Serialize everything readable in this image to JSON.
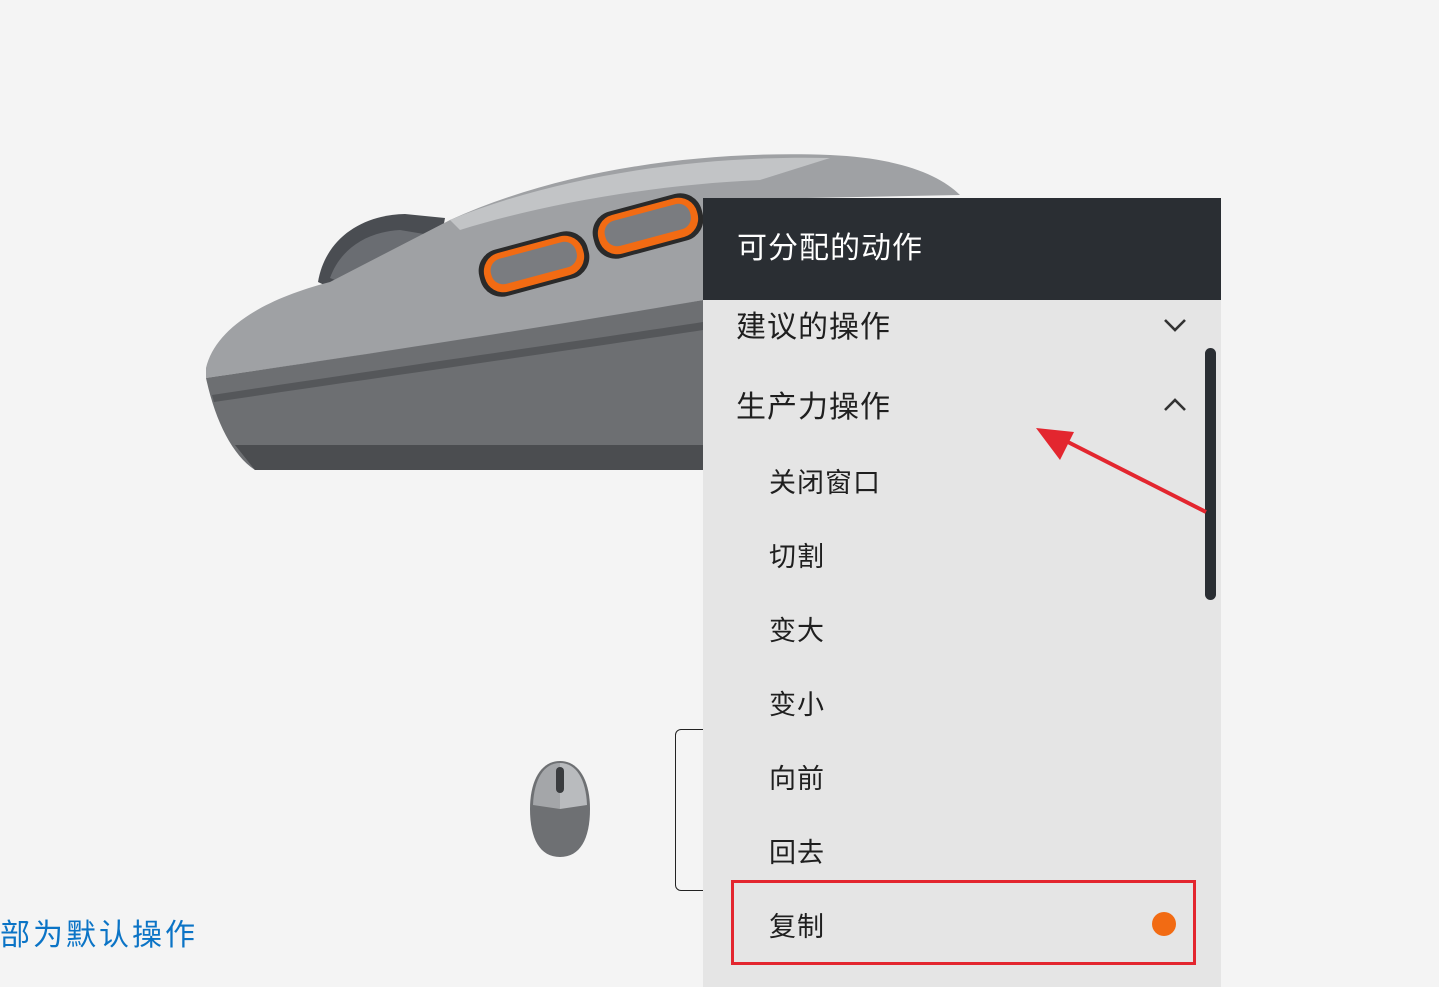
{
  "panel": {
    "title": "可分配的动作",
    "sections": [
      {
        "label": "建议的操作",
        "expanded": false,
        "icon": "chevron-down-icon"
      },
      {
        "label": "生产力操作",
        "expanded": true,
        "icon": "chevron-up-icon"
      }
    ],
    "items": [
      {
        "label": "关闭窗口"
      },
      {
        "label": "切割"
      },
      {
        "label": "变大"
      },
      {
        "label": "变小"
      },
      {
        "label": "向前"
      },
      {
        "label": "回去"
      },
      {
        "label": "复制",
        "selected": true
      }
    ]
  },
  "reset_link": "部为默认操作",
  "colors": {
    "accent_orange": "#f26b13",
    "header_dark": "#2a2e33",
    "annotation_red": "#e3262f",
    "link_blue": "#0b74c6"
  }
}
